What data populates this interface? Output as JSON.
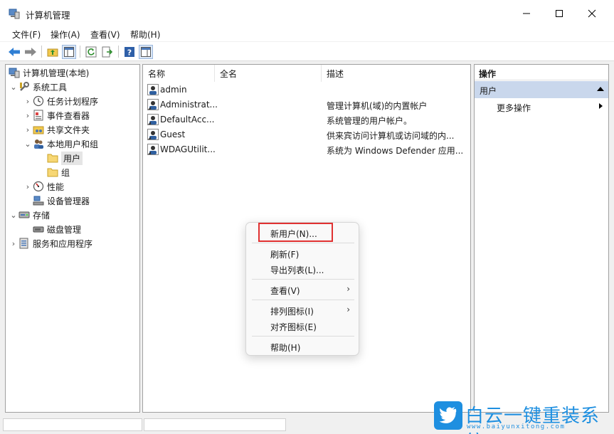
{
  "window": {
    "title": "计算机管理"
  },
  "menubar": {
    "items": [
      "文件(F)",
      "操作(A)",
      "查看(V)",
      "帮助(H)"
    ]
  },
  "tree": {
    "root": "计算机管理(本地)",
    "system_tools": "系统工具",
    "task_scheduler": "任务计划程序",
    "event_viewer": "事件查看器",
    "shared_folders": "共享文件夹",
    "local_users_groups": "本地用户和组",
    "users": "用户",
    "groups": "组",
    "performance": "性能",
    "device_manager": "设备管理器",
    "storage": "存储",
    "disk_management": "磁盘管理",
    "services_apps": "服务和应用程序"
  },
  "list": {
    "columns": [
      "名称",
      "全名",
      "描述"
    ],
    "rows": [
      {
        "name": "admin",
        "fullname": "",
        "description": ""
      },
      {
        "name": "Administrat...",
        "fullname": "",
        "description": "管理计算机(域)的内置帐户"
      },
      {
        "name": "DefaultAcc...",
        "fullname": "",
        "description": "系统管理的用户帐户。"
      },
      {
        "name": "Guest",
        "fullname": "",
        "description": "供来宾访问计算机或访问域的内..."
      },
      {
        "name": "WDAGUtilit...",
        "fullname": "",
        "description": "系统为 Windows Defender 应用..."
      }
    ]
  },
  "actions": {
    "header": "操作",
    "section": "用户",
    "more": "更多操作"
  },
  "context_menu": {
    "new_user": "新用户(N)...",
    "refresh": "刷新(F)",
    "export_list": "导出列表(L)...",
    "view": "查看(V)",
    "arrange_icons": "排列图标(I)",
    "line_up_icons": "对齐图标(E)",
    "help": "帮助(H)"
  },
  "watermark": {
    "title": "白云一键重装系统",
    "url": "www.baiyunxitong.com"
  },
  "colors": {
    "accent": "#1e8fe0",
    "highlight_box": "#e03131",
    "actions_section_bg": "#c9d7ec"
  }
}
